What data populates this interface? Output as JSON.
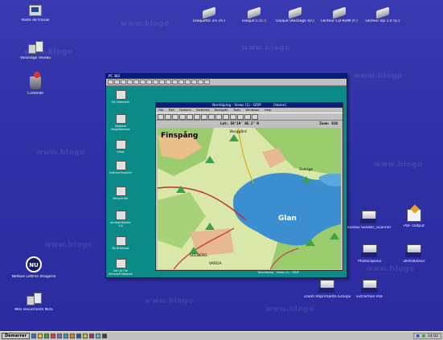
{
  "desktop": {
    "icons_left": [
      {
        "label": "Poste de travail",
        "icon": "computer-icon"
      },
      {
        "label": "Voisinage réseau",
        "icon": "network-icon"
      },
      {
        "label": "Corbeille",
        "icon": "recycle-bin-icon"
      },
      {
        "label": "Nettoie Lettres Imagerie",
        "icon": "nu-icon"
      },
      {
        "label": "Mes Documents Nico",
        "icon": "group-icon"
      }
    ],
    "icons_top": [
      {
        "label": "Disquette 3½ (A:)",
        "icon": "floppy-drive-icon"
      },
      {
        "label": "Disque C:(C:)",
        "icon": "hard-drive-icon"
      },
      {
        "label": "Disque Stockage (D:)",
        "icon": "hard-drive-icon"
      },
      {
        "label": "Lecteur CD-ROM (F:)",
        "icon": "cdrom-drive-icon"
      },
      {
        "label": "Lecteur zip 1.0 (G:)",
        "icon": "zip-drive-icon"
      }
    ],
    "icons_right": [
      {
        "label": "Bureau Solutec_Scanner",
        "icon": "printer-icon"
      },
      {
        "label": "PDF Output",
        "icon": "pdf-writer-icon"
      },
      {
        "label": "Photocopieur",
        "icon": "printer-icon"
      },
      {
        "label": "Distributeur",
        "icon": "printer-icon"
      },
      {
        "label": "Zoom Imprimante Groupe",
        "icon": "printer-icon"
      },
      {
        "label": "Extraction PDF",
        "icon": "printer-icon"
      }
    ],
    "watermark": "www.blogo"
  },
  "screen": {
    "title": "PC 382",
    "icons": [
      {
        "label": "My Computer"
      },
      {
        "label": "Network Neighborhood"
      },
      {
        "label": "Inbox"
      },
      {
        "label": "Internet Explorer"
      },
      {
        "label": "Recycle Bin"
      },
      {
        "label": "Acrobat Reader 4.0"
      },
      {
        "label": "My Briefcase"
      },
      {
        "label": "Set Up The Microsoft Network"
      }
    ]
  },
  "map_window": {
    "title": "Norrköping - Views (1) - GRIP",
    "title_tag": "[Home]",
    "menu": [
      "File",
      "Edit",
      "Options",
      "Selected",
      "Navigate",
      "Tools",
      "Windows",
      "Help"
    ],
    "lat": "Lat: 58°19' 05.1\" N",
    "zoom": "Zoom: 016",
    "map_labels": {
      "town": "Finspång",
      "lake": "Glan",
      "place1": "Sverige",
      "place2": "Borggård",
      "place3": "VARGA",
      "place4": "SOLBERG"
    },
    "status": "Norrköping - Views (1) - GRIP"
  },
  "taskbar": {
    "start_label": "Démarrer",
    "clock": "14:02"
  },
  "colors": {
    "desktop": "#3535a8",
    "screen_bg": "#0a8b88",
    "titlebar": "#0a1d78",
    "lake": "#3b8fd0",
    "forest": "#8fc36a",
    "marker": "#3aa34a"
  }
}
